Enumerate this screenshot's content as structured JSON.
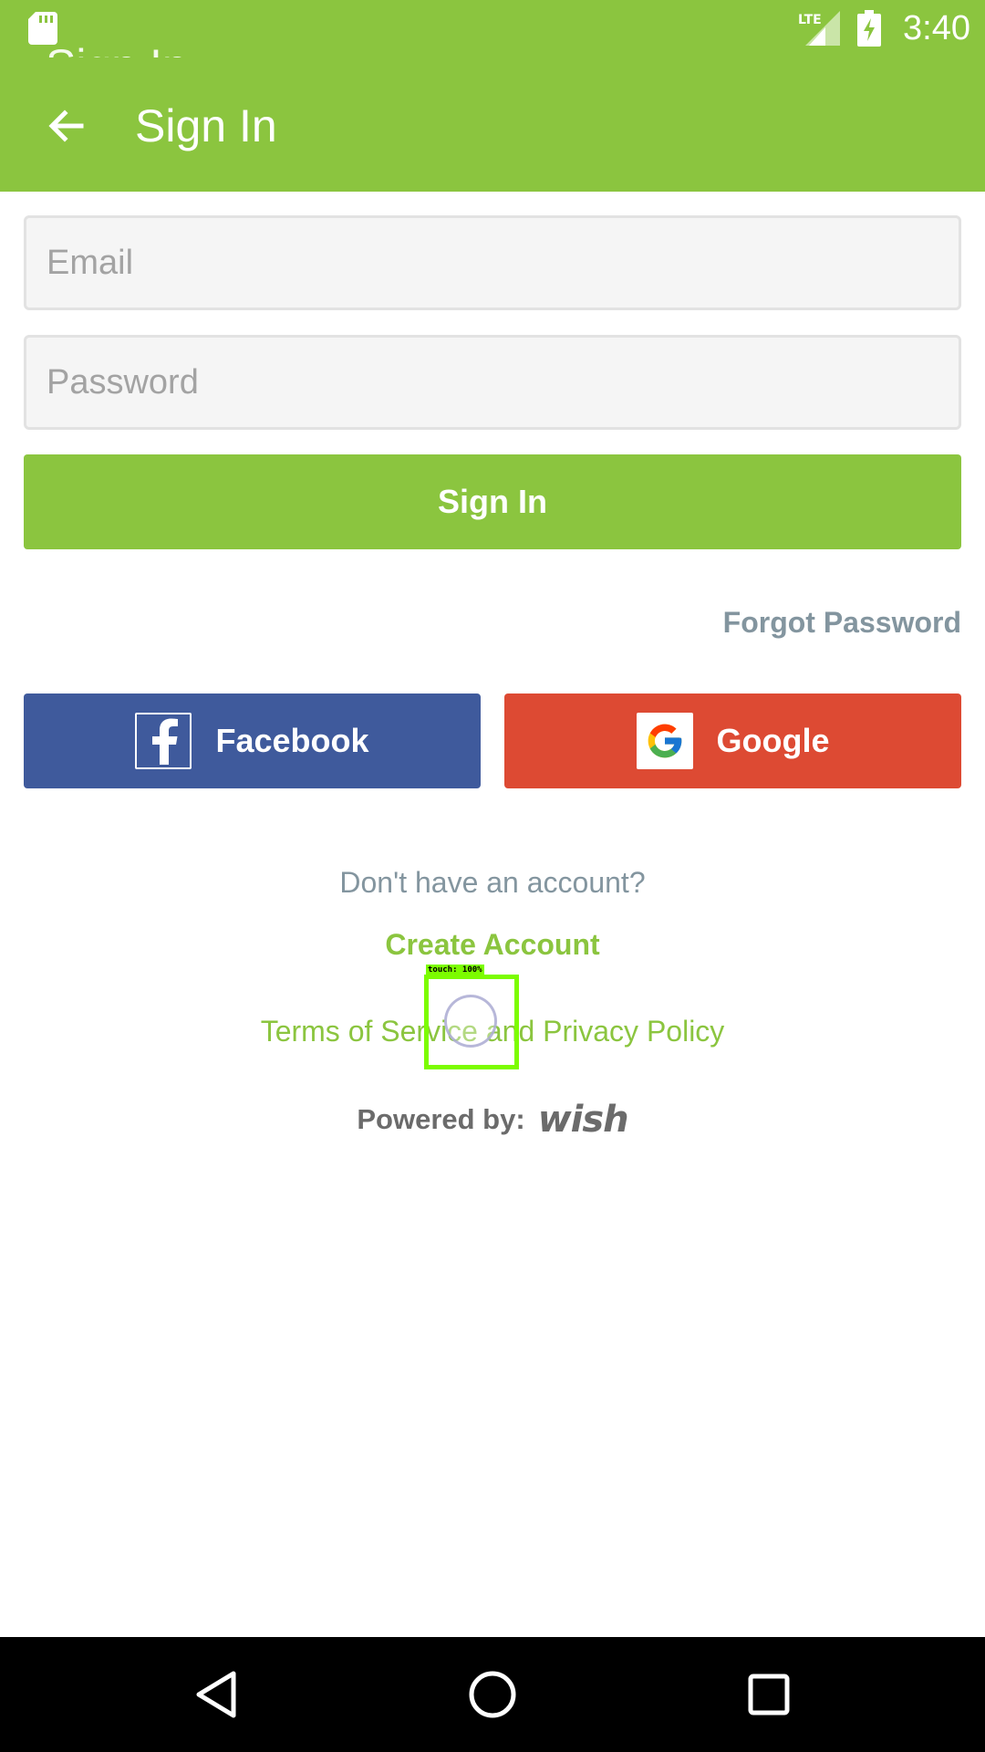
{
  "status_bar": {
    "time": "3:40",
    "network": "LTE",
    "icons": [
      "sd-card-icon",
      "lte-signal-icon",
      "battery-charging-icon"
    ]
  },
  "toolbar": {
    "title": "Sign In",
    "ghost_title": "Sign In",
    "back_icon": "arrow-back-icon"
  },
  "form": {
    "email_placeholder": "Email",
    "password_placeholder": "Password",
    "sign_in_label": "Sign In",
    "forgot_password_label": "Forgot Password"
  },
  "social": {
    "facebook_label": "Facebook",
    "google_label": "Google"
  },
  "footer": {
    "no_account_text": "Don't have an account?",
    "create_account_label": "Create Account",
    "legal_text": "Terms of Service and Privacy Policy",
    "powered_by_label": "Powered by:",
    "brand_logo_text": "wish"
  },
  "touch_indicator": {
    "label": "touch: 100%"
  },
  "nav_bar": {
    "icons": [
      "nav-back-icon",
      "nav-home-icon",
      "nav-recents-icon"
    ]
  },
  "colors": {
    "brand_green": "#8bc53f",
    "facebook_blue": "#3f5a9c",
    "google_red": "#dd4a33",
    "muted_text": "#83959f",
    "field_bg": "#f5f5f5"
  }
}
